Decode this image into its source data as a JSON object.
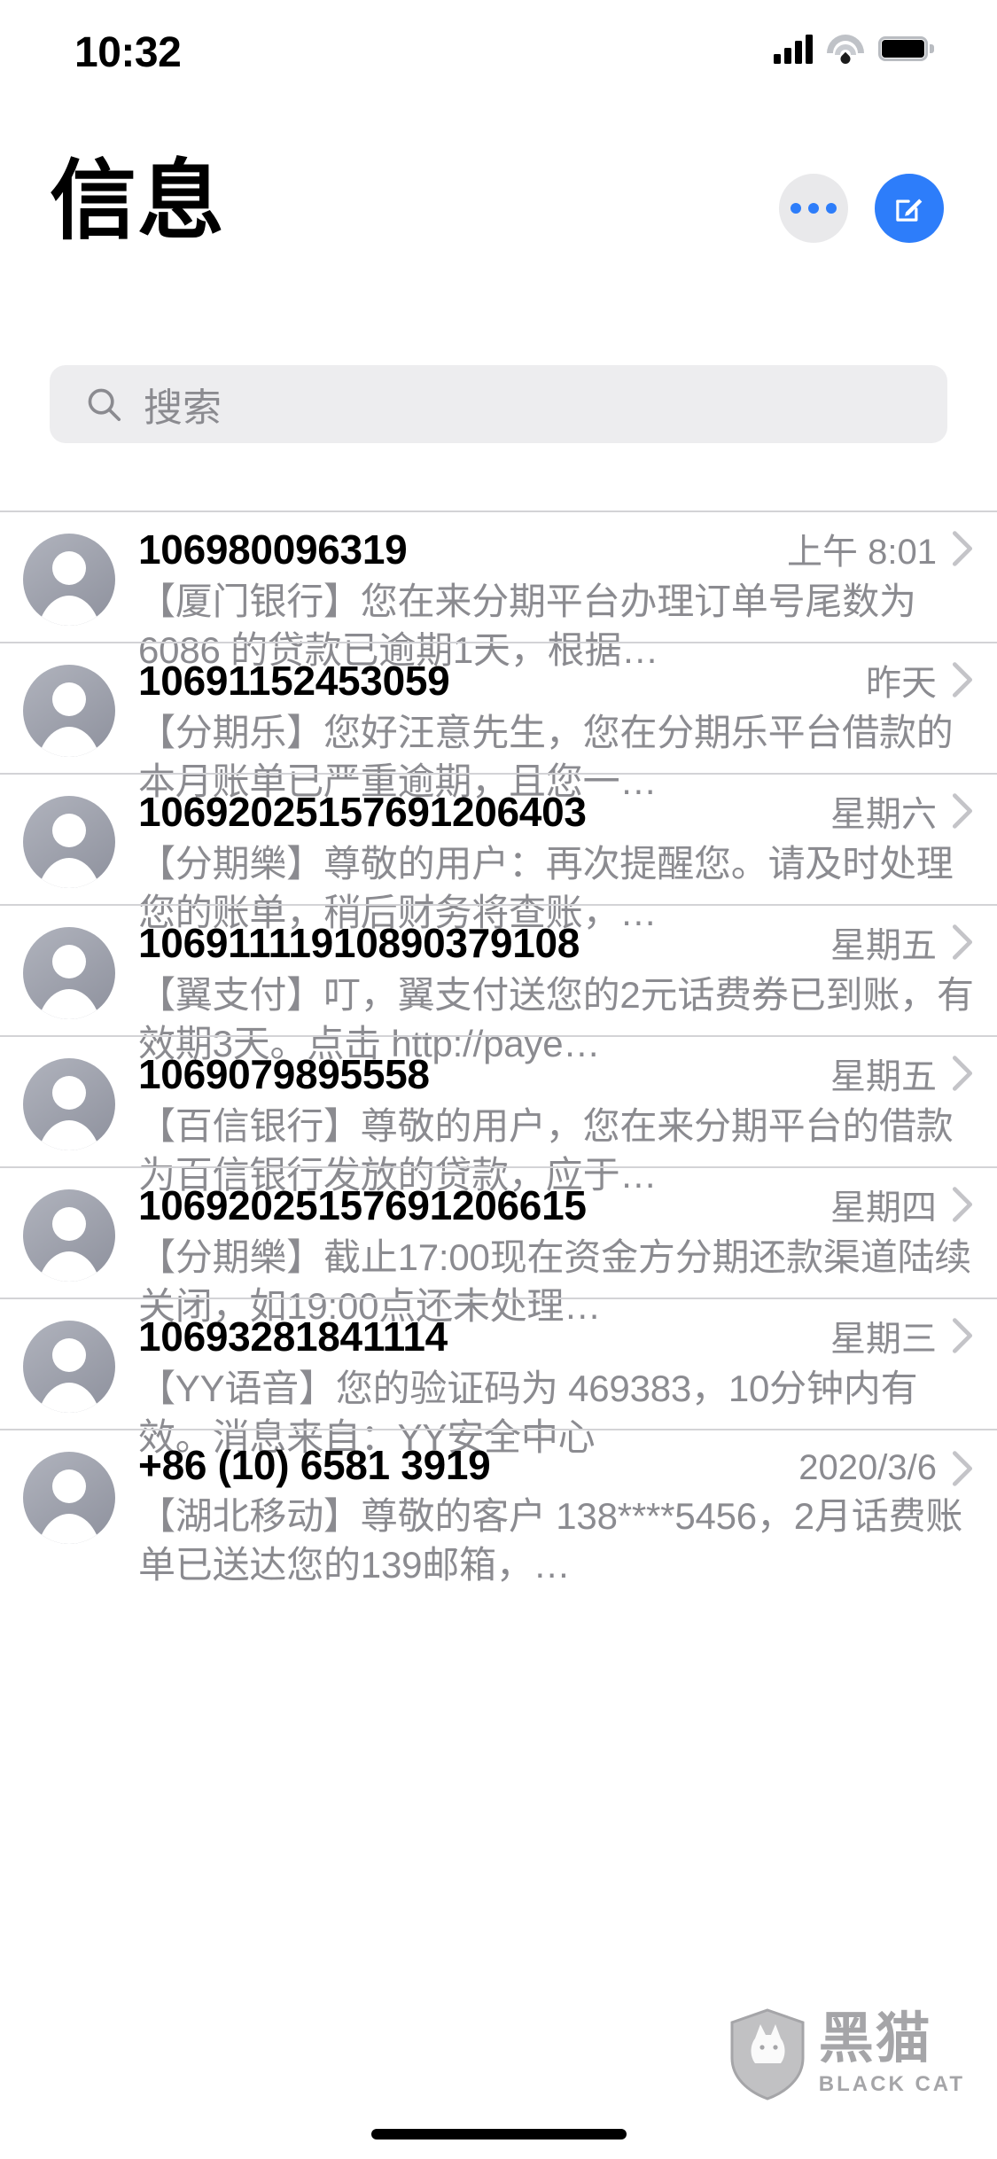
{
  "status_bar": {
    "time": "10:32",
    "icons": {
      "cellular": "signal-bars-icon",
      "wifi": "wifi-icon",
      "battery": "battery-icon"
    }
  },
  "header": {
    "title": "信息",
    "more_button": "more-options-button",
    "compose_button": "compose-message-button"
  },
  "search": {
    "placeholder": "搜索",
    "value": "",
    "icon": "search-icon"
  },
  "conversations": [
    {
      "sender": "106980096319",
      "timestamp": "上午 8:01",
      "preview": "【厦门银行】您在来分期平台办理订单号尾数为 6086 的贷款已逾期1天，根据…",
      "avatar": "default-contact-avatar",
      "chevron": "chevron-right-icon"
    },
    {
      "sender": "10691152453059",
      "timestamp": "昨天",
      "preview": "【分期乐】您好汪意先生，您在分期乐平台借款的本月账单已严重逾期，且您一…",
      "avatar": "default-contact-avatar",
      "chevron": "chevron-right-icon"
    },
    {
      "sender": "10692025157691206403",
      "timestamp": "星期六",
      "preview": "【分期樂】尊敬的用户：再次提醒您。请及时处理您的账单，稍后财务将查账，…",
      "avatar": "default-contact-avatar",
      "chevron": "chevron-right-icon"
    },
    {
      "sender": "10691111910890379108",
      "timestamp": "星期五",
      "preview": "【翼支付】叮，翼支付送您的2元话费券已到账，有效期3天。点击 http://paye…",
      "avatar": "default-contact-avatar",
      "chevron": "chevron-right-icon"
    },
    {
      "sender": "1069079895558",
      "timestamp": "星期五",
      "preview": "【百信银行】尊敬的用户，您在来分期平台的借款为百信银行发放的贷款，应于…",
      "avatar": "default-contact-avatar",
      "chevron": "chevron-right-icon"
    },
    {
      "sender": "10692025157691206615",
      "timestamp": "星期四",
      "preview": "【分期樂】截止17:00现在资金方分期还款渠道陆续关闭，如19:00点还未处理…",
      "avatar": "default-contact-avatar",
      "chevron": "chevron-right-icon"
    },
    {
      "sender": "10693281841114",
      "timestamp": "星期三",
      "preview": "【YY语音】您的验证码为 469383，10分钟内有效。消息来自：YY安全中心",
      "avatar": "default-contact-avatar",
      "chevron": "chevron-right-icon"
    },
    {
      "sender": "+86 (10) 6581 3919",
      "timestamp": "2020/3/6",
      "preview": "【湖北移动】尊敬的客户 138****5456，2月话费账单已送达您的139邮箱，…",
      "avatar": "default-contact-avatar",
      "chevron": "chevron-right-icon"
    }
  ],
  "watermark": {
    "cn": "黑猫",
    "en": "BLACK CAT",
    "icon": "black-cat-shield-logo"
  },
  "colors": {
    "accent_blue": "#2d7dfa",
    "secondary_text": "#8b8b90",
    "separator": "#d3d3d6",
    "search_bg": "#ededef",
    "more_bg": "#e9e9eb",
    "avatar_gray": "#8e919d"
  }
}
